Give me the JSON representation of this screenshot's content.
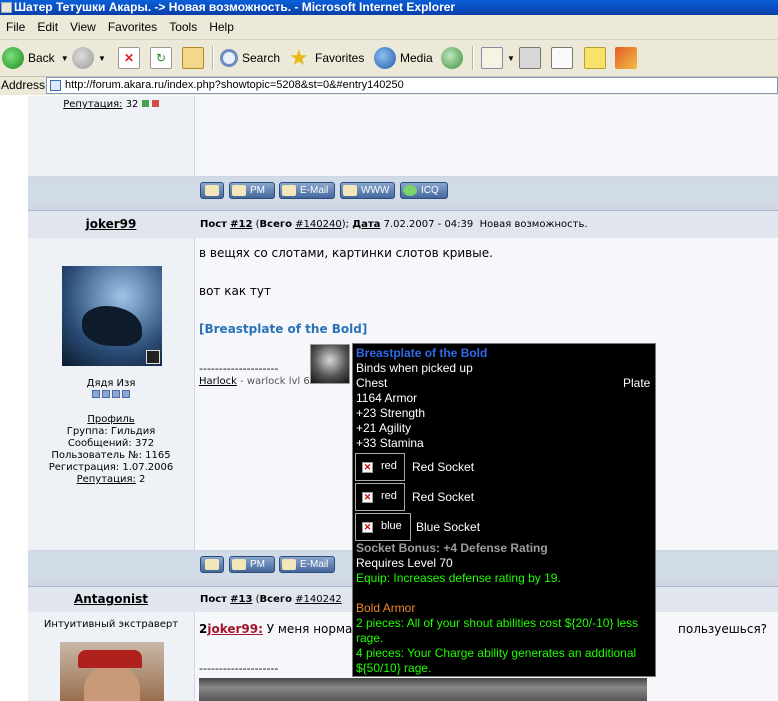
{
  "window": {
    "title": "Шатер Тетушки Акары. -> Новая возможность. - Microsoft Internet Explorer"
  },
  "menu": [
    "File",
    "Edit",
    "View",
    "Favorites",
    "Tools",
    "Help"
  ],
  "toolbar": {
    "back": "Back",
    "search": "Search",
    "favorites": "Favorites",
    "media": "Media"
  },
  "address": {
    "label": "Address",
    "url": "http://forum.akara.ru/index.php?showtopic=5208&st=0&#entry140250"
  },
  "prev_post": {
    "reputation_label": "Репутация:",
    "reputation_value": "32"
  },
  "buttons": {
    "pm": "PM",
    "email": "E-Mail",
    "www": "WWW",
    "icq": "ICQ"
  },
  "post12": {
    "author": "joker99",
    "post_label": "Пост",
    "post_num": "#12",
    "total_label": "Всего",
    "total_num": "#140240",
    "date_label": "Дата",
    "date": "7.02.2007 - 04:39",
    "subject": "Новая возможность.",
    "body_line1": "в вещях со слотами, картинки слотов кривые.",
    "body_line2": "вот как тут",
    "item_link": "[Breastplate of the Bold]",
    "sig_sep": "--------------------",
    "sig_name": "Harlock",
    "sig_text": "- warlock lvl 60",
    "user_title": "Дядя Изя",
    "profile": "Профиль",
    "group": "Группа: Гильдия",
    "messages": "Сообщений: 372",
    "user_no": "Пользователь №: 1165",
    "registered": "Регистрация: 1.07.2006",
    "reputation_label": "Репутация:",
    "reputation_value": "2"
  },
  "post13": {
    "author": "Antagonist",
    "post_label": "Пост",
    "post_num": "#13",
    "total_label": "Всего",
    "total_num": "#140242",
    "user_title": "Интуитивный экстраверт",
    "body_prefix": "2",
    "body_mention": "joker99:",
    "body_text": " У меня норма",
    "body_text_right": "пользуешься?",
    "sig_sep": "--------------------"
  },
  "tooltip": {
    "name": "Breastplate of the Bold",
    "binds": "Binds when picked up",
    "slot": "Chest",
    "type": "Plate",
    "armor": "1164 Armor",
    "str": "+23 Strength",
    "agi": "+21 Agility",
    "sta": "+33 Stamina",
    "sockets": [
      {
        "img": "red",
        "label": "Red Socket"
      },
      {
        "img": "red",
        "label": "Red Socket"
      },
      {
        "img": "blue",
        "label": "Blue Socket"
      }
    ],
    "socket_bonus": "Socket Bonus: +4 Defense Rating",
    "req": "Requires Level 70",
    "equip": "Equip: Increases defense rating by 19.",
    "set_name": "Bold Armor",
    "set2a": "2 pieces: All of your shout abilities cost ${20/-10} less",
    "set2b": "rage.",
    "set4a": "4 pieces: Your Charge ability generates an additional",
    "set4b": "${50/10} rage."
  },
  "colors": {
    "tooltip_title": "#2f6be8",
    "green": "#1eff00",
    "grey": "#9d9d9d",
    "orange": "#ffd100",
    "set_orange": "#e9882c"
  }
}
